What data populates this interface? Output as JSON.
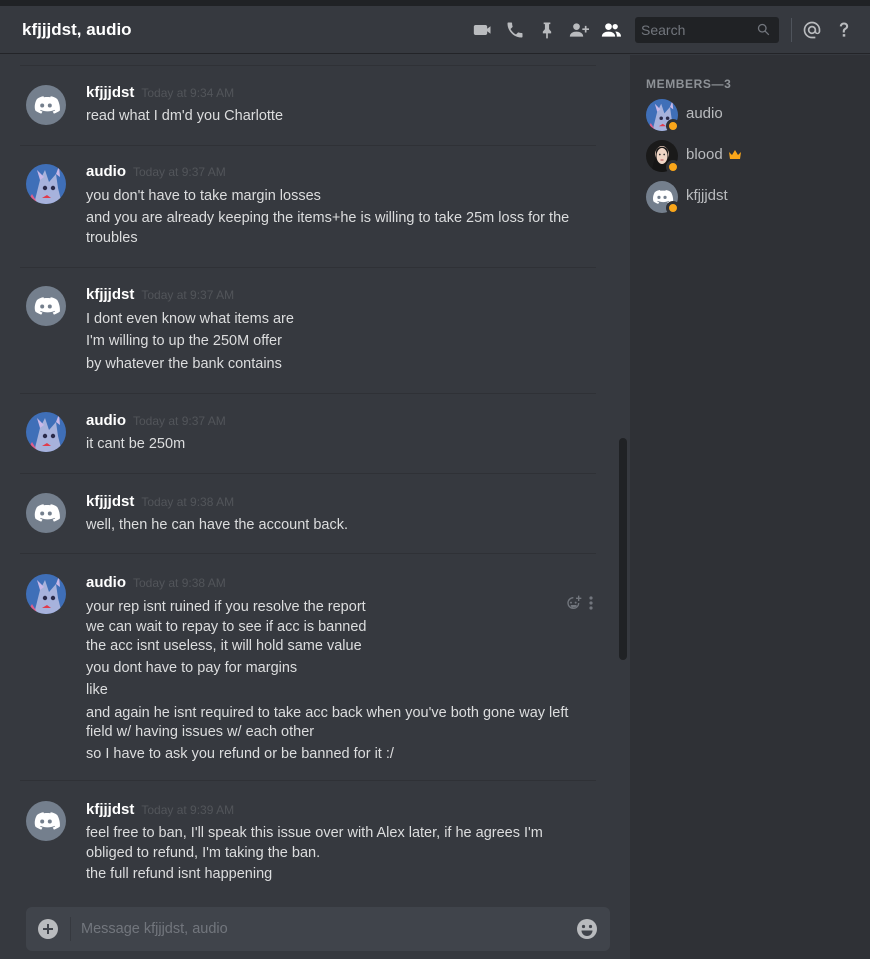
{
  "channel": {
    "title": "kfjjjdst, audio"
  },
  "header": {
    "search_placeholder": "Search",
    "icons": [
      "video-call-icon",
      "voice-call-icon",
      "pin-icon",
      "add-friend-icon",
      "member-list-icon",
      "search-icon",
      "mention-icon",
      "help-icon"
    ]
  },
  "messages": [
    {
      "author": "kfjjjdst",
      "timestamp": "Today at 9:34 AM",
      "avatar": "discord-default-icon",
      "lines": [
        "read what I dm'd you Charlotte"
      ]
    },
    {
      "author": "audio",
      "timestamp": "Today at 9:37 AM",
      "avatar": "anime-cat-avatar",
      "lines": [
        "you don't have to take margin losses",
        "and you are already keeping the items+he is willing to take 25m loss for the",
        "troubles"
      ]
    },
    {
      "author": "kfjjjdst",
      "timestamp": "Today at 9:37 AM",
      "avatar": "discord-default-icon",
      "lines": [
        "I dont even know what items are",
        "I'm willing to up the 250M offer",
        "by whatever the bank contains"
      ]
    },
    {
      "author": "audio",
      "timestamp": "Today at 9:37 AM",
      "avatar": "anime-cat-avatar",
      "lines": [
        "it cant be 250m"
      ]
    },
    {
      "author": "kfjjjdst",
      "timestamp": "Today at 9:38 AM",
      "avatar": "discord-default-icon",
      "lines": [
        "well, then he can have the account back."
      ]
    },
    {
      "author": "audio",
      "timestamp": "Today at 9:38 AM",
      "avatar": "anime-cat-avatar",
      "lines": [
        "your rep isnt ruined if you resolve the report",
        "we can wait to repay to see if acc is banned",
        "the acc isnt useless, it will hold same value",
        "you dont have to pay for margins",
        "like",
        "and again he isnt required to take acc back when you've both gone way left",
        "field w/ having issues w/ each other",
        "so I have to ask you refund or be banned for it :/"
      ]
    },
    {
      "author": "kfjjjdst",
      "timestamp": "Today at 9:39 AM",
      "avatar": "discord-default-icon",
      "lines": [
        "feel free to ban, I'll speak this issue over with Alex later, if he agrees I'm",
        "obliged to refund, I'm taking the ban.",
        "the full refund isnt happening"
      ]
    }
  ],
  "composer": {
    "placeholder": "Message kfjjjdst, audio"
  },
  "members": {
    "header": "MEMBERS—3",
    "list": [
      {
        "name": "audio",
        "status": "idle",
        "avatar": "anime-cat-avatar",
        "owner": false
      },
      {
        "name": "blood",
        "status": "idle",
        "avatar": "woman-portrait-avatar",
        "owner": true
      },
      {
        "name": "kfjjjdst",
        "status": "idle",
        "avatar": "discord-default-icon",
        "owner": false
      }
    ]
  },
  "colors": {
    "background": "#36393f",
    "sidebar": "#2f3136",
    "input": "#40444b",
    "idle_status": "#faa61a",
    "owner_crown": "#faa61a",
    "default_avatar": "#747f8d"
  }
}
